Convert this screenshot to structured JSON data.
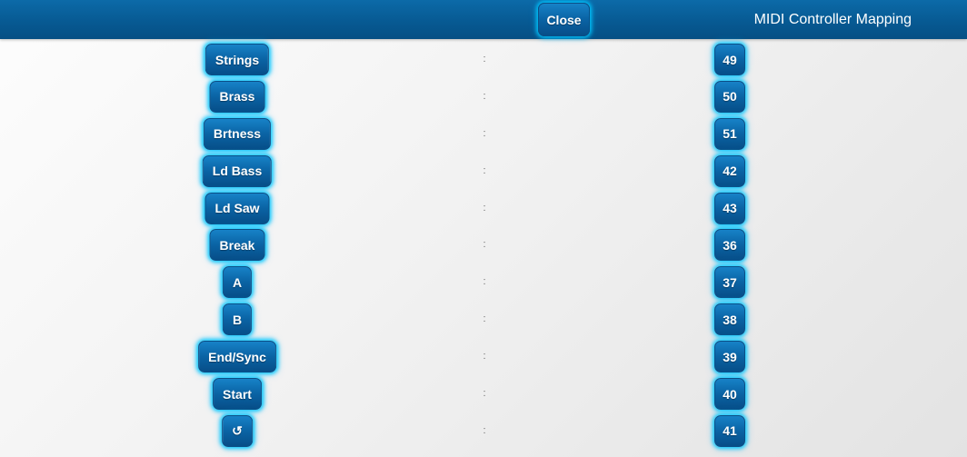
{
  "header": {
    "title": "MIDI Controller Mapping",
    "close_label": "Close"
  },
  "separator": ":",
  "mappings": [
    {
      "label": "Strings",
      "value": "49"
    },
    {
      "label": "Brass",
      "value": "50"
    },
    {
      "label": "Brtness",
      "value": "51"
    },
    {
      "label": "Ld Bass",
      "value": "42"
    },
    {
      "label": "Ld Saw",
      "value": "43"
    },
    {
      "label": "Break",
      "value": "36"
    },
    {
      "label": "A",
      "value": "37"
    },
    {
      "label": "B",
      "value": "38"
    },
    {
      "label": "End/Sync",
      "value": "39"
    },
    {
      "label": "Start",
      "value": "40"
    },
    {
      "label": "↺",
      "value": "41"
    }
  ],
  "colors": {
    "header": "#075a93",
    "button": "#0a63a4",
    "glow": "#00c8ff"
  }
}
